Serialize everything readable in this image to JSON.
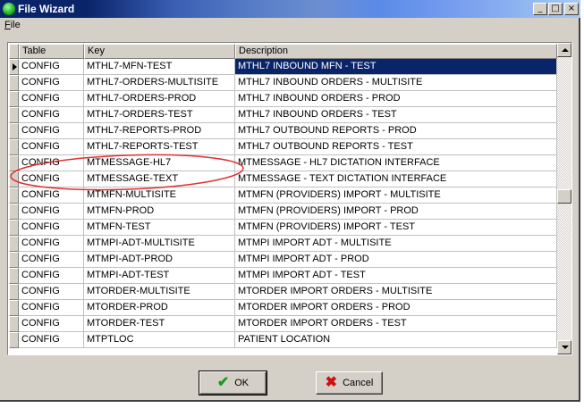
{
  "window": {
    "title": "File Wizard"
  },
  "title_buttons": {
    "minimize": "_",
    "maximize": "□",
    "close": "×"
  },
  "menu": {
    "file_first": "F",
    "file_rest": "ile"
  },
  "table": {
    "columns": [
      "Table",
      "Key",
      "Description"
    ],
    "selected_index": 0,
    "rows": [
      {
        "table": "CONFIG",
        "key": "MTHL7-MFN-TEST",
        "desc": "MTHL7 INBOUND MFN - TEST"
      },
      {
        "table": "CONFIG",
        "key": "MTHL7-ORDERS-MULTISITE",
        "desc": "MTHL7 INBOUND ORDERS - MULTISITE"
      },
      {
        "table": "CONFIG",
        "key": "MTHL7-ORDERS-PROD",
        "desc": "MTHL7 INBOUND ORDERS - PROD"
      },
      {
        "table": "CONFIG",
        "key": "MTHL7-ORDERS-TEST",
        "desc": "MTHL7 INBOUND ORDERS - TEST"
      },
      {
        "table": "CONFIG",
        "key": "MTHL7-REPORTS-PROD",
        "desc": "MTHL7 OUTBOUND REPORTS - PROD"
      },
      {
        "table": "CONFIG",
        "key": "MTHL7-REPORTS-TEST",
        "desc": "MTHL7 OUTBOUND REPORTS - TEST"
      },
      {
        "table": "CONFIG",
        "key": "MTMESSAGE-HL7",
        "desc": "MTMESSAGE - HL7 DICTATION INTERFACE"
      },
      {
        "table": "CONFIG",
        "key": "MTMESSAGE-TEXT",
        "desc": "MTMESSAGE - TEXT DICTATION INTERFACE"
      },
      {
        "table": "CONFIG",
        "key": "MTMFN-MULTISITE",
        "desc": "MTMFN (PROVIDERS) IMPORT - MULTISITE"
      },
      {
        "table": "CONFIG",
        "key": "MTMFN-PROD",
        "desc": "MTMFN (PROVIDERS) IMPORT - PROD"
      },
      {
        "table": "CONFIG",
        "key": "MTMFN-TEST",
        "desc": "MTMFN (PROVIDERS) IMPORT - TEST"
      },
      {
        "table": "CONFIG",
        "key": "MTMPI-ADT-MULTISITE",
        "desc": "MTMPI IMPORT ADT - MULTISITE"
      },
      {
        "table": "CONFIG",
        "key": "MTMPI-ADT-PROD",
        "desc": "MTMPI IMPORT ADT - PROD"
      },
      {
        "table": "CONFIG",
        "key": "MTMPI-ADT-TEST",
        "desc": "MTMPI IMPORT ADT - TEST"
      },
      {
        "table": "CONFIG",
        "key": "MTORDER-MULTISITE",
        "desc": "MTORDER IMPORT ORDERS - MULTISITE"
      },
      {
        "table": "CONFIG",
        "key": "MTORDER-PROD",
        "desc": "MTORDER IMPORT ORDERS - PROD"
      },
      {
        "table": "CONFIG",
        "key": "MTORDER-TEST",
        "desc": "MTORDER IMPORT ORDERS - TEST"
      },
      {
        "table": "CONFIG",
        "key": "MTPTLOC",
        "desc": "PATIENT LOCATION"
      }
    ]
  },
  "buttons": {
    "ok": "OK",
    "cancel": "Cancel"
  },
  "colors": {
    "selection": "#0a246a",
    "annotation": "#e03030"
  }
}
